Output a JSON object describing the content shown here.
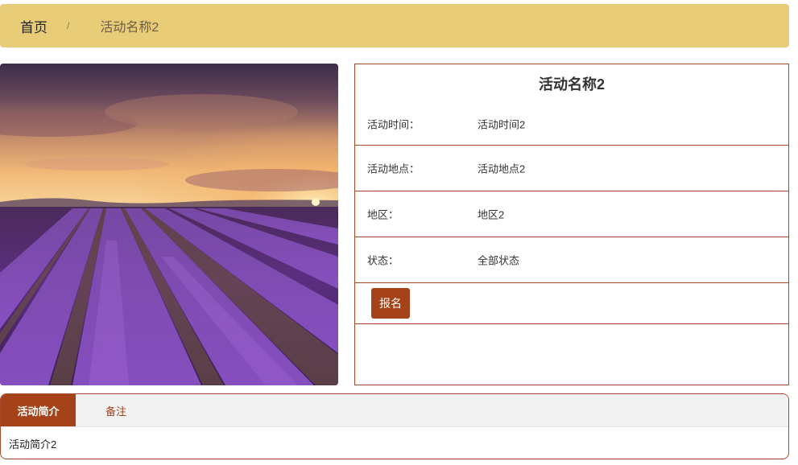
{
  "breadcrumb": {
    "home": "首页",
    "separator": "/",
    "current": "活动名称2"
  },
  "photo": {
    "subject": "lavender-field-sunset-image"
  },
  "detail": {
    "title": "活动名称2",
    "rows": [
      {
        "label": "活动时间：",
        "value": "活动时间2"
      },
      {
        "label": "活动地点：",
        "value": "活动地点2"
      },
      {
        "label": "地区：",
        "value": "地区2"
      },
      {
        "label": "状态：",
        "value": "全部状态"
      }
    ],
    "signup_label": "报名"
  },
  "tabs": {
    "items": [
      {
        "label": "活动简介",
        "active": true
      },
      {
        "label": "备注",
        "active": false
      }
    ],
    "content": "活动简介2"
  },
  "colors": {
    "breadcrumb_bg": "#e8cc78",
    "accent": "#a5421a",
    "border": "#a5492b",
    "tab_bar_bg": "#f2f2f2"
  }
}
